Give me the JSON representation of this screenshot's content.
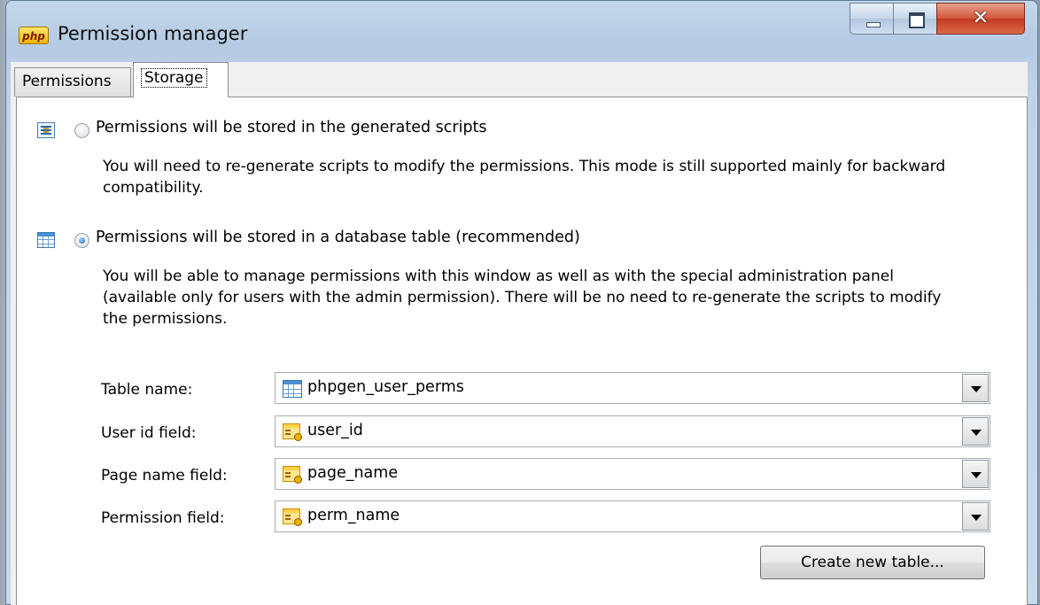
{
  "window": {
    "title": "Permission manager",
    "app_icon_text": "php",
    "minimize": "minimize",
    "maximize": "maximize",
    "close_glyph": "✕"
  },
  "tabs": [
    {
      "label": "Permissions",
      "selected": false
    },
    {
      "label": "Storage",
      "selected": true
    }
  ],
  "storage": {
    "option_scripts": {
      "label": "Permissions will be stored in the generated scripts",
      "description": "You will need to re-generate scripts to modify the permissions. This mode is still supported mainly for backward compatibility.",
      "selected": false,
      "icon": "script-icon"
    },
    "option_db": {
      "label": "Permissions will be stored in a database table (recommended)",
      "description": "You will be able to manage permissions with this window as well as with the special administration panel (available only for users with the admin permission). There will be no need to re-generate the scripts to modify the permissions.",
      "selected": true,
      "icon": "table-icon"
    },
    "fields": [
      {
        "label": "Table name:",
        "value": "phpgen_user_perms",
        "icon": "table-icon"
      },
      {
        "label": "User id field:",
        "value": "user_id",
        "icon": "field-icon"
      },
      {
        "label": "Page name field:",
        "value": "page_name",
        "icon": "field-icon"
      },
      {
        "label": "Permission field:",
        "value": "perm_name",
        "icon": "field-icon"
      }
    ],
    "create_button": "Create new table..."
  },
  "colors": {
    "window_frame": "#b5cbe3",
    "close_button": "#c23a1f",
    "radio_selected": "#1a5fb4"
  }
}
